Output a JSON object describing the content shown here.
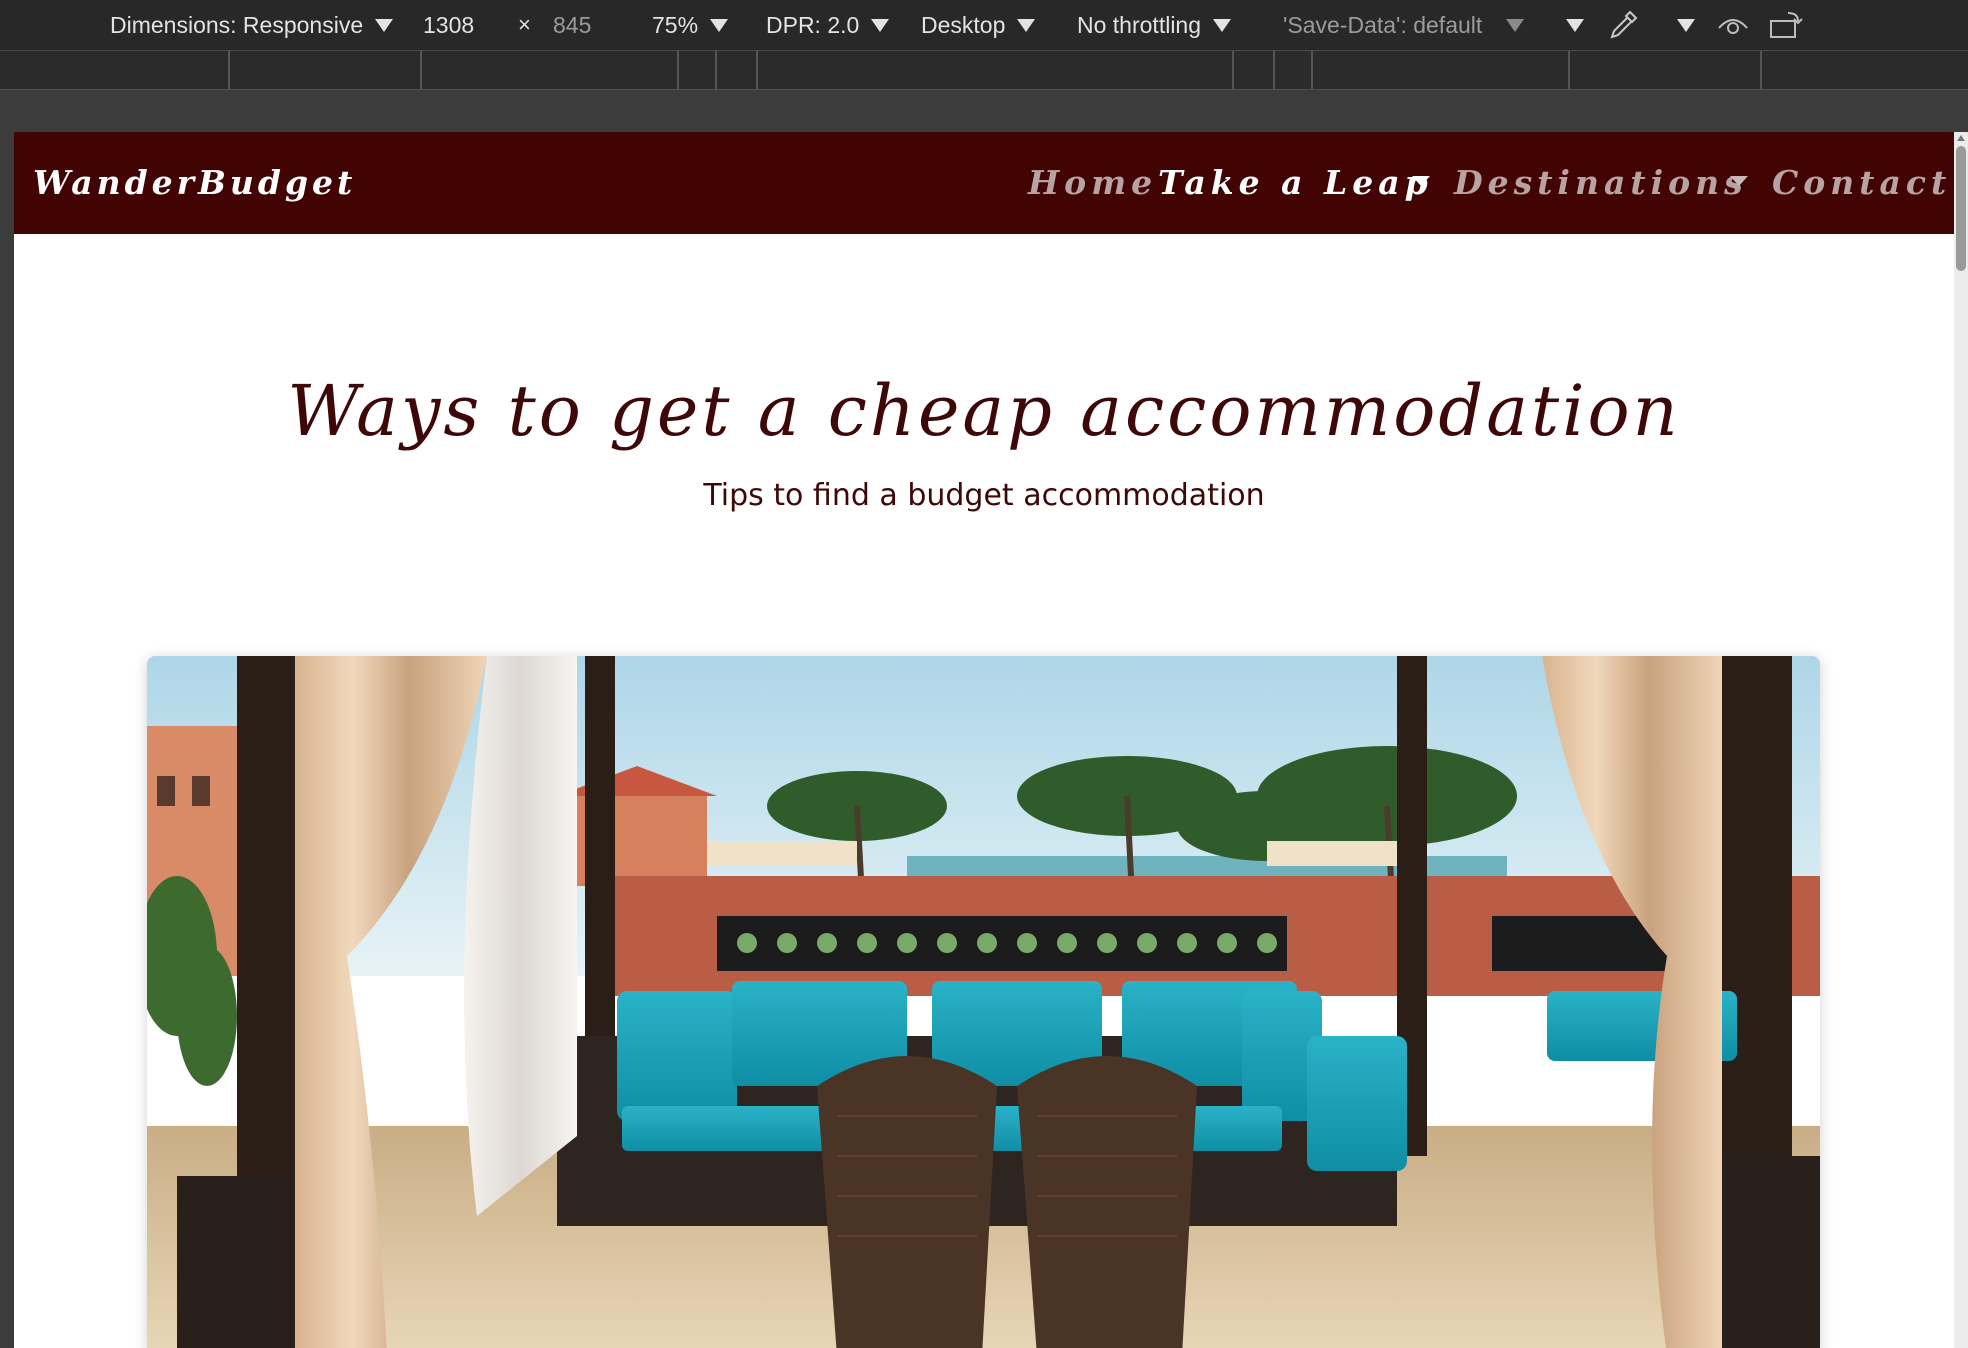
{
  "devtools": {
    "dimensions_label": "Dimensions: Responsive",
    "width_value": "1308",
    "times_symbol": "×",
    "height_value": "845",
    "zoom": "75%",
    "dpr": "DPR: 2.0",
    "device_type": "Desktop",
    "throttling": "No throttling",
    "save_data": "'Save-Data': default"
  },
  "site": {
    "brand": "WanderBudget",
    "nav": [
      {
        "label": "Home",
        "active": false,
        "has_dropdown": false
      },
      {
        "label": "Take a Leap",
        "active": true,
        "has_dropdown": true
      },
      {
        "label": "Destinations",
        "active": false,
        "has_dropdown": true
      },
      {
        "label": "Contact",
        "active": false,
        "has_dropdown": false
      }
    ]
  },
  "page": {
    "heading": "Ways to get a cheap accommodation",
    "subheading": "Tips to find a budget accommodation"
  },
  "colors": {
    "navbar_bg": "#420303",
    "heading_color": "#3e0808",
    "toolbar_bg": "#282828"
  },
  "icons": {
    "eyedropper": "eyedropper-icon",
    "vision": "eye-icon",
    "rotate": "rotate-icon"
  }
}
